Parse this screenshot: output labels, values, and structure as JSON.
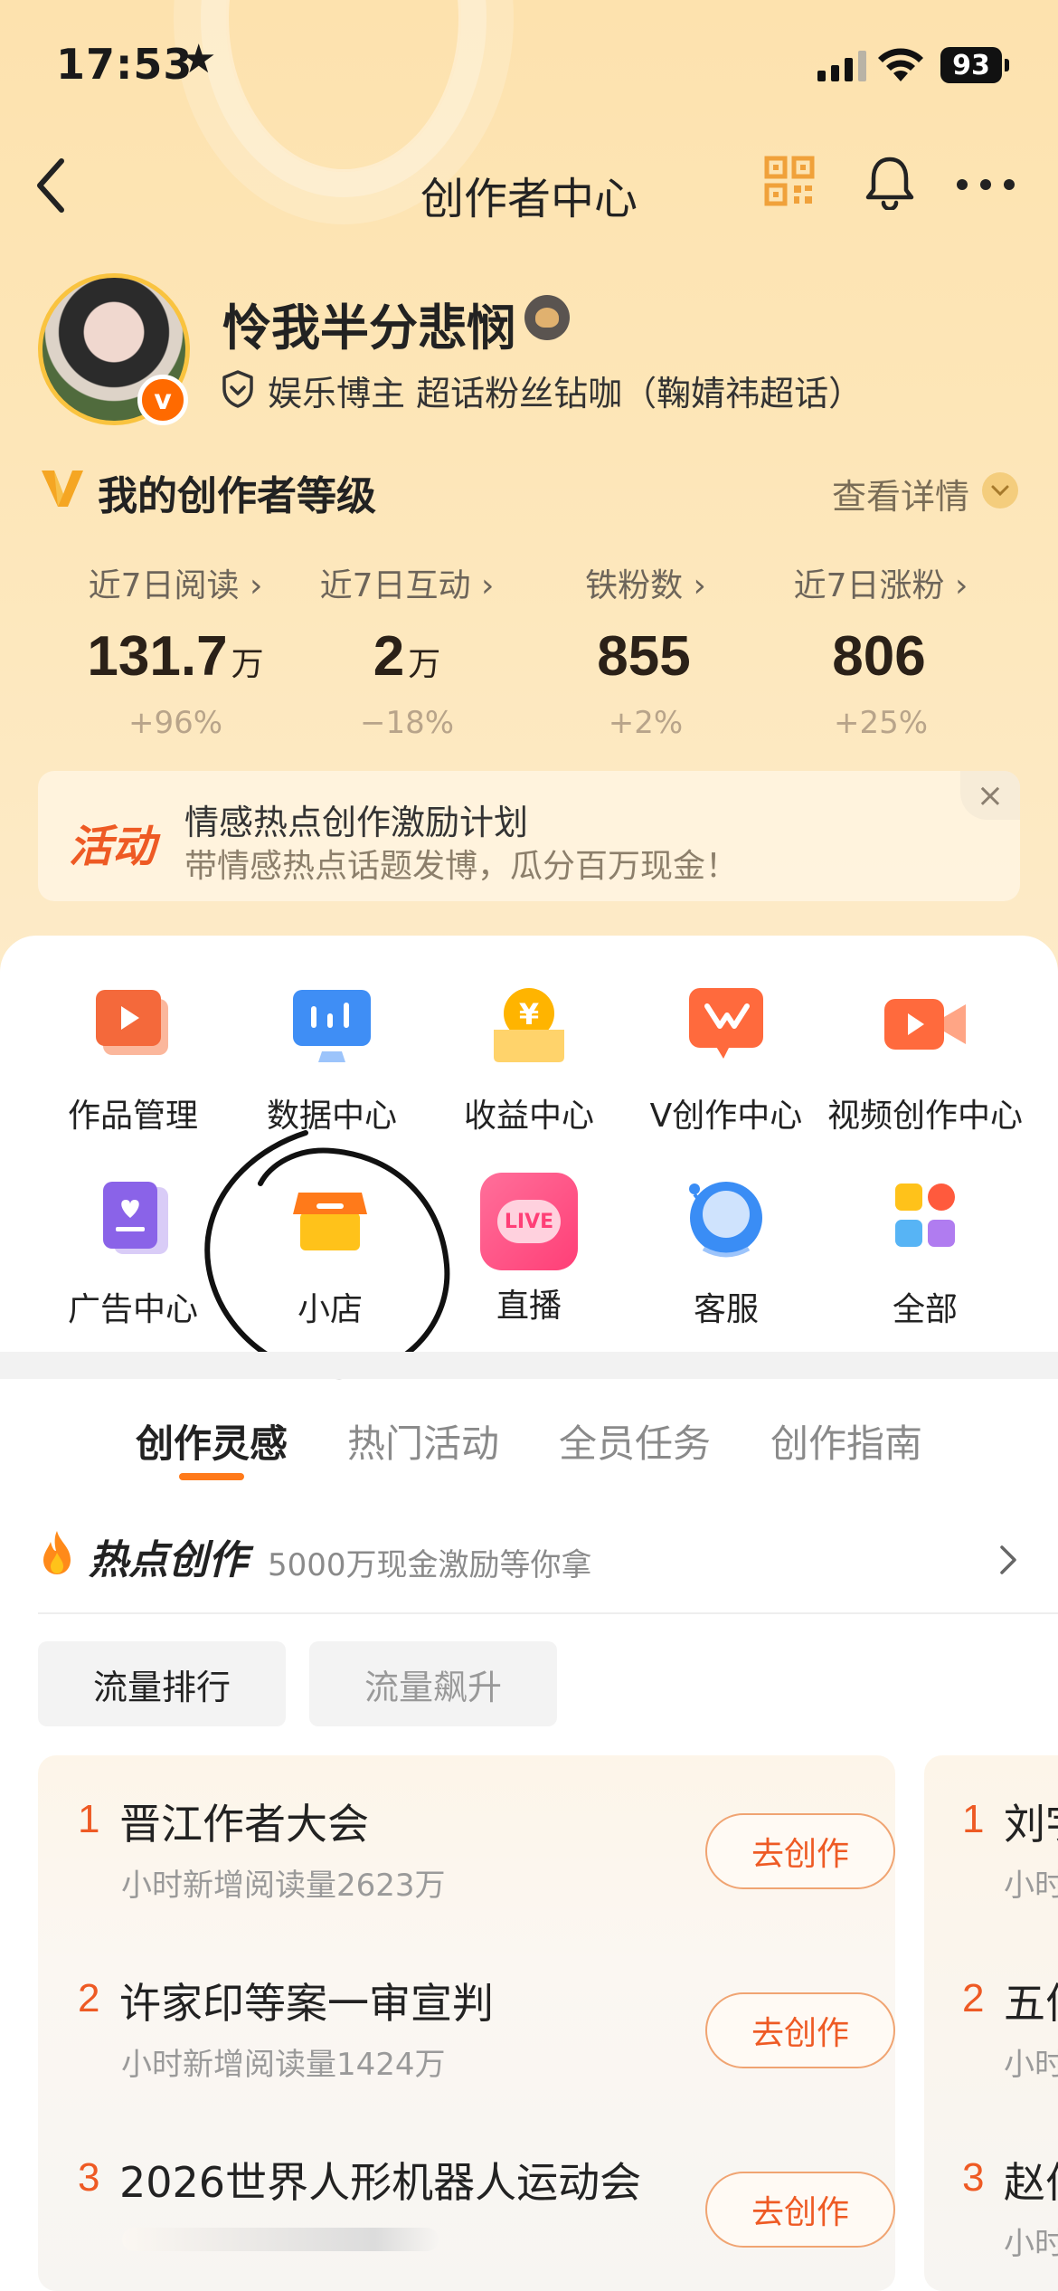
{
  "status_bar": {
    "time": "17:53",
    "star": "★",
    "battery": "93"
  },
  "nav": {
    "title": "创作者中心"
  },
  "profile": {
    "username": "怜我半分悲悯",
    "title": "娱乐博主 超话粉丝钻咖（鞠婧祎超话）",
    "badge": "v"
  },
  "level": {
    "title": "我的创作者等级",
    "detail": "查看详情"
  },
  "stats": [
    {
      "label": "近7日阅读 ›",
      "value": "131.7",
      "unit": "万",
      "change": "+96%"
    },
    {
      "label": "近7日互动 ›",
      "value": "2",
      "unit": "万",
      "change": "−18%"
    },
    {
      "label": "铁粉数 ›",
      "value": "855",
      "unit": "",
      "change": "+2%"
    },
    {
      "label": "近7日涨粉 ›",
      "value": "806",
      "unit": "",
      "change": "+25%"
    }
  ],
  "banner": {
    "tag": "活动",
    "title": "情感热点创作激励计划",
    "subtitle": "带情感热点话题发博，瓜分百万现金！",
    "close": "×"
  },
  "grid": [
    {
      "label": "作品管理",
      "icon": "works-icon"
    },
    {
      "label": "数据中心",
      "icon": "data-icon"
    },
    {
      "label": "收益中心",
      "icon": "income-icon"
    },
    {
      "label": "V创作中心",
      "icon": "v-creator-icon"
    },
    {
      "label": "视频创作中心",
      "icon": "video-icon"
    },
    {
      "label": "广告中心",
      "icon": "ad-icon"
    },
    {
      "label": "小店",
      "icon": "shop-icon"
    },
    {
      "label": "直播",
      "icon": "live-icon"
    },
    {
      "label": "客服",
      "icon": "service-icon"
    },
    {
      "label": "全部",
      "icon": "all-icon"
    }
  ],
  "tabs": [
    "创作灵感",
    "热门活动",
    "全员任务",
    "创作指南"
  ],
  "hot": {
    "title": "热点创作",
    "subtitle": "5000万现金激励等你拿"
  },
  "chips": [
    "流量排行",
    "流量飙升"
  ],
  "ranking": [
    {
      "num": "1",
      "title": "晋江作者大会",
      "sub": "小时新增阅读量2623万",
      "button": "去创作"
    },
    {
      "num": "2",
      "title": "许家印等案一审宣判",
      "sub": "小时新增阅读量1424万",
      "button": "去创作"
    },
    {
      "num": "3",
      "title": "2026世界人形机器人运动会",
      "sub": "",
      "button": "去创作"
    }
  ],
  "ranking_peek": [
    {
      "num": "1",
      "title": "刘宇",
      "sub": "小时"
    },
    {
      "num": "2",
      "title": "五何",
      "sub": "小时"
    },
    {
      "num": "3",
      "title": "赵伯",
      "sub": "小时"
    }
  ],
  "live_badge": "LIVE",
  "colors": {
    "accent": "#ee5a24",
    "header_bg": "#fde2ae",
    "annotation": "#111111"
  }
}
